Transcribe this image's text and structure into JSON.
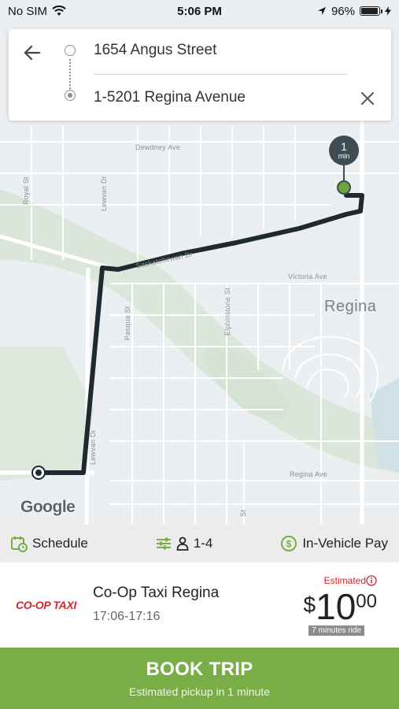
{
  "status_bar": {
    "carrier": "No SIM",
    "time": "5:06 PM",
    "battery_percent_text": "96%",
    "battery_level": 0.96
  },
  "route": {
    "origin": "1654 Angus Street",
    "destination": "1-5201 Regina Avenue"
  },
  "map": {
    "streets": {
      "dewdney": "Dewdney Ave",
      "royal": "Royal St",
      "lewvan": "Lewvan Dr",
      "saskatchewan": "Saskatchewan Dr",
      "victoria": "Victoria Ave",
      "pasqua": "Pasqua St",
      "elphinstone": "Elphinstone St",
      "lewvan2": "Lewvan Dr",
      "regina_ave": "Regina Ave",
      "albert": "St"
    },
    "city": "Regina",
    "attribution": "Google",
    "eta": {
      "value": "1",
      "unit": "min"
    }
  },
  "options": {
    "schedule": "Schedule",
    "passengers": "1-4",
    "payment": "In-Vehicle Pay"
  },
  "provider": {
    "logo_text": "CO-OP TAXI",
    "name": "Co-Op Taxi Regina",
    "time_window": "17:06-17:16",
    "estimated_label": "Estimated",
    "price_currency": "$",
    "price_main": "10",
    "price_cents": "00",
    "ride_duration": "7 minutes ride"
  },
  "book": {
    "title": "BOOK TRIP",
    "subtitle": "Estimated pickup in 1 minute"
  },
  "colors": {
    "accent_green": "#78ae45",
    "brand_red": "#d22630",
    "route_dark": "#1e2a30"
  }
}
